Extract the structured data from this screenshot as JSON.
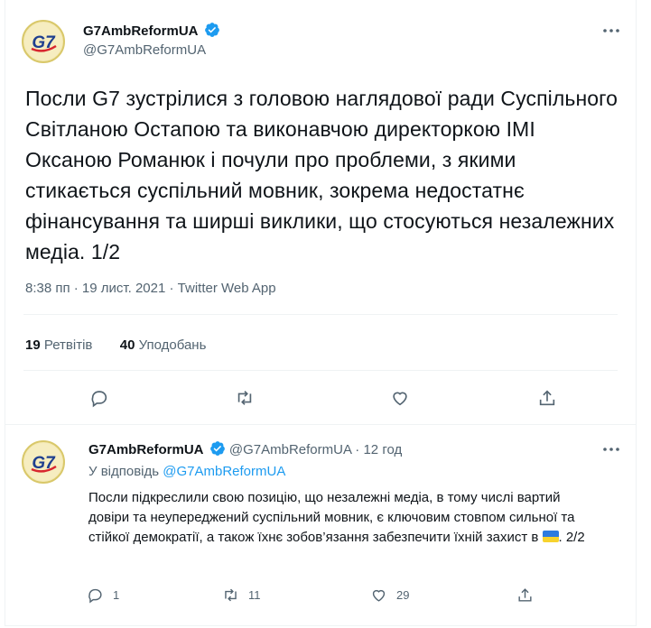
{
  "tweet": {
    "display_name": "G7AmbReformUA",
    "handle": "@G7AmbReformUA",
    "avatar_text": "G7",
    "text": "Посли G7 зустрілися з головою наглядової ради Суспільного Світланою Остапою та виконавчою директоркою ІМІ Оксаною Романюк і почули про проблеми, з якими стикається суспільний мовник, зокрема недостатнє фінансування та ширші виклики, що стосуються незалежних медіа. 1/2",
    "meta": "8:38 пп · 19 лист. 2021 · Twitter Web App",
    "retweets_count": "19",
    "retweets_label": "Ретвітів",
    "likes_count": "40",
    "likes_label": "Уподобань"
  },
  "reply": {
    "display_name": "G7AmbReformUA",
    "handle": "@G7AmbReformUA",
    "separator": "·",
    "time": "12 год",
    "replying_to_label": "У відповідь",
    "replying_to_handle": "@G7AmbReformUA",
    "text_before_flag": "Посли підкреслили свою позицію, що незалежні медіа, в тому числі вартий довіри та неупереджений суспільний мовник, є ключовим стовпом сильної та стійкої демократії, а також їхнє зобов’язання забезпечити їхній захист в",
    "text_after_flag": ". 2/2",
    "reply_count": "1",
    "retweet_count": "11",
    "like_count": "29"
  },
  "icons": {
    "verified": "verified-badge-icon",
    "more": "more-dots-icon",
    "reply": "reply-bubble-icon",
    "retweet": "retweet-icon",
    "like": "heart-icon",
    "share": "share-icon",
    "flag": "ukraine-flag-icon"
  },
  "colors": {
    "accent": "#1d9bf0",
    "text": "#0f1419",
    "secondary": "#536471",
    "divider": "#eff3f4"
  }
}
